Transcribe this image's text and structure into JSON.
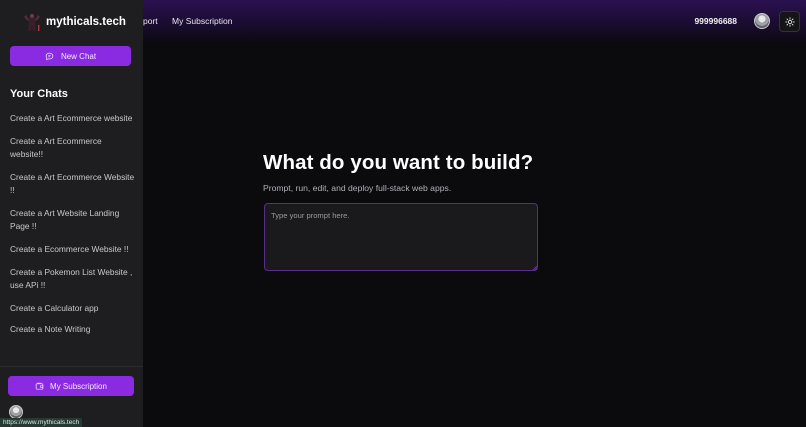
{
  "header": {
    "nav": [
      {
        "label": "port"
      },
      {
        "label": "My Subscription"
      }
    ],
    "phone": "999996688"
  },
  "sidebar": {
    "brand": "mythicals.tech",
    "new_chat_label": "New Chat",
    "chats_title": "Your Chats",
    "chats": [
      {
        "label": "Create a Art Ecommerce website"
      },
      {
        "label": "Create a Art Ecommerce website!!"
      },
      {
        "label": "Create a Art Ecommerce Website !!"
      },
      {
        "label": "Create a Art Website Landing Page !!"
      },
      {
        "label": "Create a Ecommerce Website !!"
      },
      {
        "label": "Create a Pokemon List Website , use APi !!"
      },
      {
        "label": "Create a Calculator app"
      },
      {
        "label": "Create a Note Writing"
      }
    ],
    "subscription_label": "My Subscription"
  },
  "main": {
    "title": "What do you want to build?",
    "subtitle": "Prompt, run, edit, and deploy full-stack web apps.",
    "prompt_placeholder": "Type your prompt here.",
    "prompt_value": ""
  },
  "status_bar": {
    "url": "https://www.mythicals.tech"
  },
  "colors": {
    "accent": "#8a2be2",
    "sidebar_bg": "#1e1e20",
    "page_bg": "#0b0a0d",
    "header_gradient_top": "#2b1150"
  },
  "icons": {
    "new_chat": "chat-bubble-icon",
    "subscription": "wallet-icon",
    "theme_toggle": "sun-icon",
    "brand": "mythical-logo-icon"
  }
}
